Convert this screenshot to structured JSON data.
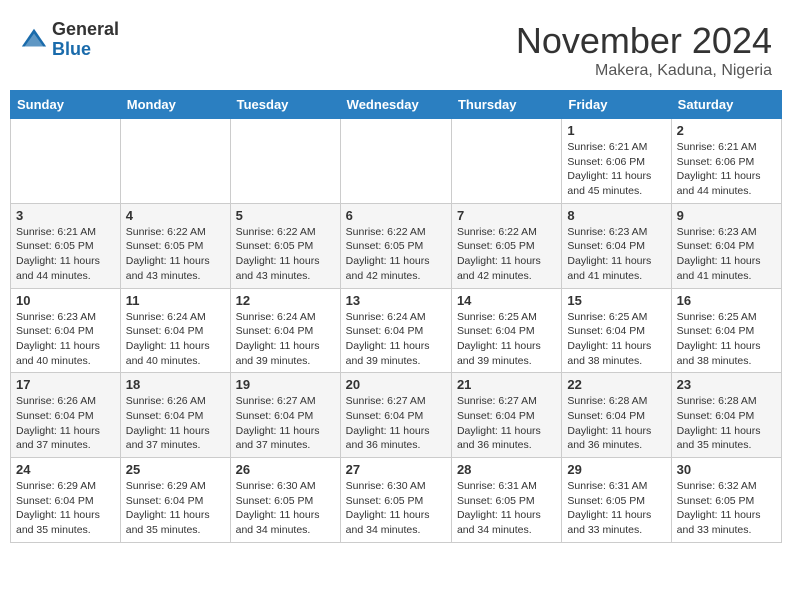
{
  "logo": {
    "general": "General",
    "blue": "Blue"
  },
  "header": {
    "month": "November 2024",
    "location": "Makera, Kaduna, Nigeria"
  },
  "weekdays": [
    "Sunday",
    "Monday",
    "Tuesday",
    "Wednesday",
    "Thursday",
    "Friday",
    "Saturday"
  ],
  "weeks": [
    [
      {
        "day": "",
        "info": ""
      },
      {
        "day": "",
        "info": ""
      },
      {
        "day": "",
        "info": ""
      },
      {
        "day": "",
        "info": ""
      },
      {
        "day": "",
        "info": ""
      },
      {
        "day": "1",
        "info": "Sunrise: 6:21 AM\nSunset: 6:06 PM\nDaylight: 11 hours and 45 minutes."
      },
      {
        "day": "2",
        "info": "Sunrise: 6:21 AM\nSunset: 6:06 PM\nDaylight: 11 hours and 44 minutes."
      }
    ],
    [
      {
        "day": "3",
        "info": "Sunrise: 6:21 AM\nSunset: 6:05 PM\nDaylight: 11 hours and 44 minutes."
      },
      {
        "day": "4",
        "info": "Sunrise: 6:22 AM\nSunset: 6:05 PM\nDaylight: 11 hours and 43 minutes."
      },
      {
        "day": "5",
        "info": "Sunrise: 6:22 AM\nSunset: 6:05 PM\nDaylight: 11 hours and 43 minutes."
      },
      {
        "day": "6",
        "info": "Sunrise: 6:22 AM\nSunset: 6:05 PM\nDaylight: 11 hours and 42 minutes."
      },
      {
        "day": "7",
        "info": "Sunrise: 6:22 AM\nSunset: 6:05 PM\nDaylight: 11 hours and 42 minutes."
      },
      {
        "day": "8",
        "info": "Sunrise: 6:23 AM\nSunset: 6:04 PM\nDaylight: 11 hours and 41 minutes."
      },
      {
        "day": "9",
        "info": "Sunrise: 6:23 AM\nSunset: 6:04 PM\nDaylight: 11 hours and 41 minutes."
      }
    ],
    [
      {
        "day": "10",
        "info": "Sunrise: 6:23 AM\nSunset: 6:04 PM\nDaylight: 11 hours and 40 minutes."
      },
      {
        "day": "11",
        "info": "Sunrise: 6:24 AM\nSunset: 6:04 PM\nDaylight: 11 hours and 40 minutes."
      },
      {
        "day": "12",
        "info": "Sunrise: 6:24 AM\nSunset: 6:04 PM\nDaylight: 11 hours and 39 minutes."
      },
      {
        "day": "13",
        "info": "Sunrise: 6:24 AM\nSunset: 6:04 PM\nDaylight: 11 hours and 39 minutes."
      },
      {
        "day": "14",
        "info": "Sunrise: 6:25 AM\nSunset: 6:04 PM\nDaylight: 11 hours and 39 minutes."
      },
      {
        "day": "15",
        "info": "Sunrise: 6:25 AM\nSunset: 6:04 PM\nDaylight: 11 hours and 38 minutes."
      },
      {
        "day": "16",
        "info": "Sunrise: 6:25 AM\nSunset: 6:04 PM\nDaylight: 11 hours and 38 minutes."
      }
    ],
    [
      {
        "day": "17",
        "info": "Sunrise: 6:26 AM\nSunset: 6:04 PM\nDaylight: 11 hours and 37 minutes."
      },
      {
        "day": "18",
        "info": "Sunrise: 6:26 AM\nSunset: 6:04 PM\nDaylight: 11 hours and 37 minutes."
      },
      {
        "day": "19",
        "info": "Sunrise: 6:27 AM\nSunset: 6:04 PM\nDaylight: 11 hours and 37 minutes."
      },
      {
        "day": "20",
        "info": "Sunrise: 6:27 AM\nSunset: 6:04 PM\nDaylight: 11 hours and 36 minutes."
      },
      {
        "day": "21",
        "info": "Sunrise: 6:27 AM\nSunset: 6:04 PM\nDaylight: 11 hours and 36 minutes."
      },
      {
        "day": "22",
        "info": "Sunrise: 6:28 AM\nSunset: 6:04 PM\nDaylight: 11 hours and 36 minutes."
      },
      {
        "day": "23",
        "info": "Sunrise: 6:28 AM\nSunset: 6:04 PM\nDaylight: 11 hours and 35 minutes."
      }
    ],
    [
      {
        "day": "24",
        "info": "Sunrise: 6:29 AM\nSunset: 6:04 PM\nDaylight: 11 hours and 35 minutes."
      },
      {
        "day": "25",
        "info": "Sunrise: 6:29 AM\nSunset: 6:04 PM\nDaylight: 11 hours and 35 minutes."
      },
      {
        "day": "26",
        "info": "Sunrise: 6:30 AM\nSunset: 6:05 PM\nDaylight: 11 hours and 34 minutes."
      },
      {
        "day": "27",
        "info": "Sunrise: 6:30 AM\nSunset: 6:05 PM\nDaylight: 11 hours and 34 minutes."
      },
      {
        "day": "28",
        "info": "Sunrise: 6:31 AM\nSunset: 6:05 PM\nDaylight: 11 hours and 34 minutes."
      },
      {
        "day": "29",
        "info": "Sunrise: 6:31 AM\nSunset: 6:05 PM\nDaylight: 11 hours and 33 minutes."
      },
      {
        "day": "30",
        "info": "Sunrise: 6:32 AM\nSunset: 6:05 PM\nDaylight: 11 hours and 33 minutes."
      }
    ]
  ]
}
